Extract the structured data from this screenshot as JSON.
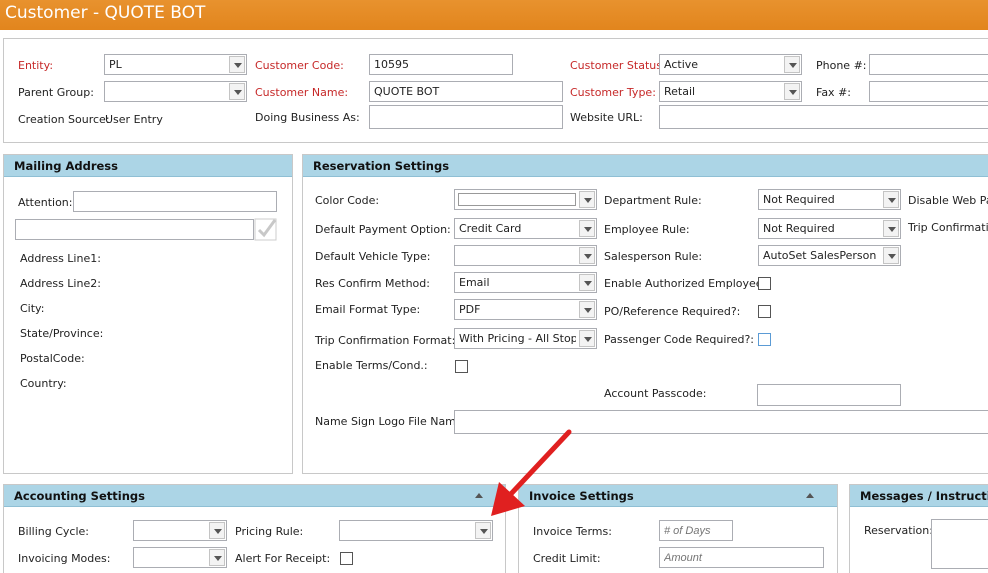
{
  "window": {
    "title": "Customer - QUOTE BOT"
  },
  "header": {
    "entity_label": "Entity:",
    "entity_value": "PL",
    "parent_group_label": "Parent Group:",
    "parent_group_value": "",
    "creation_source_label": "Creation Source:",
    "creation_source_value": "User Entry",
    "customer_code_label": "Customer Code:",
    "customer_code_value": "10595",
    "customer_name_label": "Customer Name:",
    "customer_name_value": "QUOTE BOT",
    "dba_label": "Doing Business As:",
    "dba_value": "",
    "customer_status_label": "Customer Status:",
    "customer_status_value": "Active",
    "customer_type_label": "Customer Type:",
    "customer_type_value": "Retail",
    "website_label": "Website URL:",
    "website_value": "",
    "phone_label": "Phone #:",
    "phone_value": "",
    "fax_label": "Fax #:",
    "fax_value": ""
  },
  "mailing": {
    "title": "Mailing Address",
    "attention_label": "Attention:",
    "attention_value": "",
    "address_search_value": "",
    "fields": [
      "Address Line1:",
      "Address Line2:",
      "City:",
      "State/Province:",
      "PostalCode:",
      "Country:"
    ]
  },
  "reservation": {
    "title": "Reservation Settings",
    "color_code_label": "Color Code:",
    "default_payment_label": "Default Payment Option:",
    "default_payment_value": "Credit Card",
    "default_vehicle_label": "Default Vehicle Type:",
    "default_vehicle_value": "",
    "res_confirm_label": "Res Confirm Method:",
    "res_confirm_value": "Email",
    "email_format_label": "Email Format Type:",
    "email_format_value": "PDF",
    "trip_confirm_format_label": "Trip Confirmation Format:",
    "trip_confirm_format_value": "With Pricing - All Stops I",
    "enable_terms_label": "Enable Terms/Cond.:",
    "name_sign_label": "Name Sign Logo File Name:",
    "name_sign_value": "",
    "department_rule_label": "Department Rule:",
    "department_rule_value": "Not Required",
    "employee_rule_label": "Employee Rule:",
    "employee_rule_value": "Not Required",
    "salesperson_rule_label": "Salesperson Rule:",
    "salesperson_rule_value": "AutoSet SalesPerson",
    "enable_auth_employees_label": "Enable Authorized Employees:",
    "po_reference_label": "PO/Reference Required?:",
    "passenger_code_label": "Passenger Code Required?:",
    "account_passcode_label": "Account Passcode:",
    "account_passcode_value": "",
    "disable_web_label": "Disable Web Pas",
    "trip_confirmation_label": "Trip Confirmatio"
  },
  "accounting": {
    "title": "Accounting Settings",
    "billing_cycle_label": "Billing Cycle:",
    "billing_cycle_value": "",
    "invoicing_modes_label": "Invoicing Modes:",
    "invoicing_modes_value": "",
    "pricing_rule_label": "Pricing Rule:",
    "pricing_rule_value": "",
    "alert_receipt_label": "Alert For Receipt:"
  },
  "invoice": {
    "title": "Invoice Settings",
    "terms_label": "Invoice Terms:",
    "terms_placeholder": "# of Days",
    "credit_limit_label": "Credit Limit:",
    "credit_limit_placeholder": "Amount"
  },
  "messages": {
    "title": "Messages / Instruction",
    "reservation_label": "Reservation:"
  },
  "colors": {
    "titlebar": "#e2851d",
    "section_header": "#acd5e6",
    "required_label": "#c62828",
    "arrow": "#e02020"
  },
  "annotation": {
    "arrow_icon": "red-arrow-icon"
  }
}
